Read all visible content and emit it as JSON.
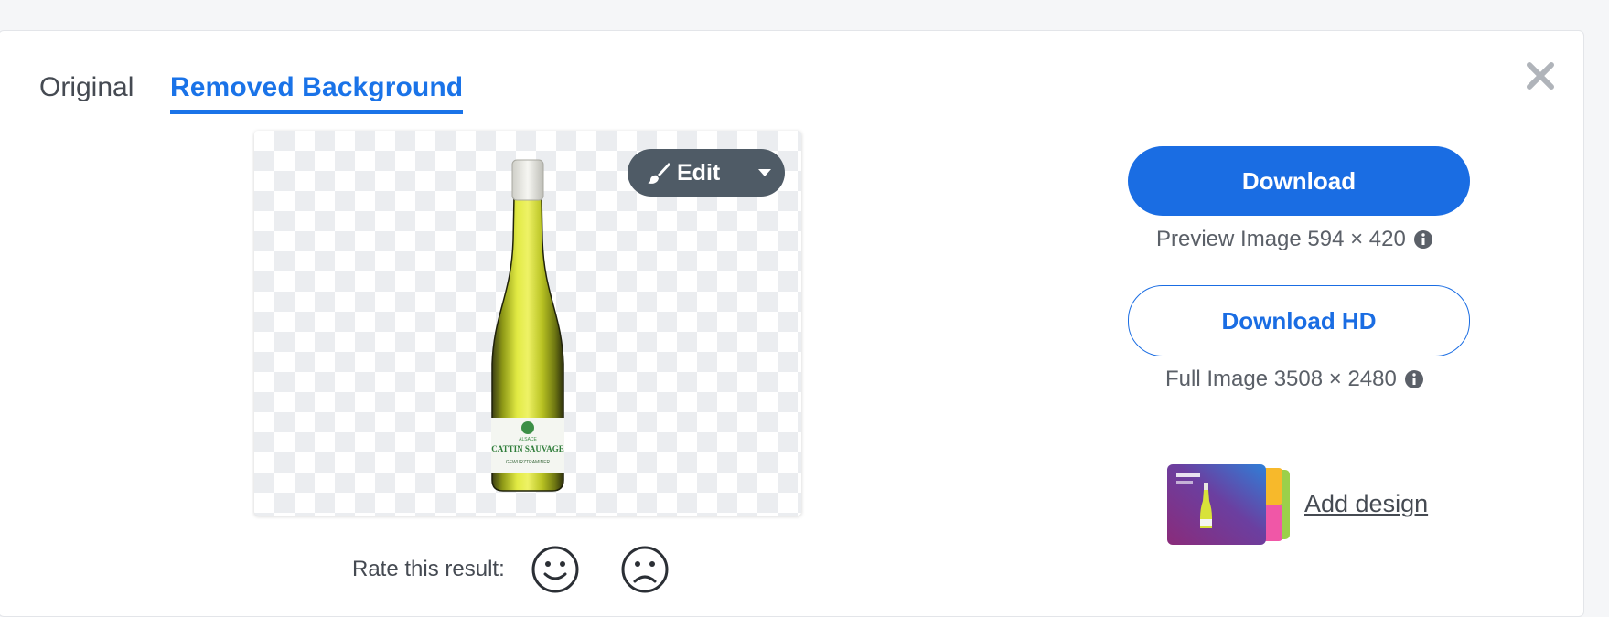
{
  "tabs": {
    "original": "Original",
    "removed_background": "Removed Background",
    "active": "removed_background"
  },
  "close_icon": "close-icon",
  "preview": {
    "edit_label": "Edit",
    "edit_icon": "paintbrush-icon",
    "dropdown_icon": "caret-down-icon",
    "bottle_label": {
      "region": "ALSACE",
      "brand": "CATTIN SAUVAGE",
      "varietal": "GEWURZTRAMINER"
    }
  },
  "rating": {
    "label": "Rate this result:",
    "positive_icon": "smiley-icon",
    "negative_icon": "frown-icon"
  },
  "download": {
    "label": "Download",
    "preview_text": "Preview Image 594 × 420",
    "hd_label": "Download HD",
    "full_text": "Full Image 3508 × 2480",
    "info_icon": "info-icon"
  },
  "design": {
    "label": "Add design"
  },
  "colors": {
    "accent": "#1a73e8",
    "edit_button_bg": "#4f5b66",
    "text": "#454a52"
  }
}
